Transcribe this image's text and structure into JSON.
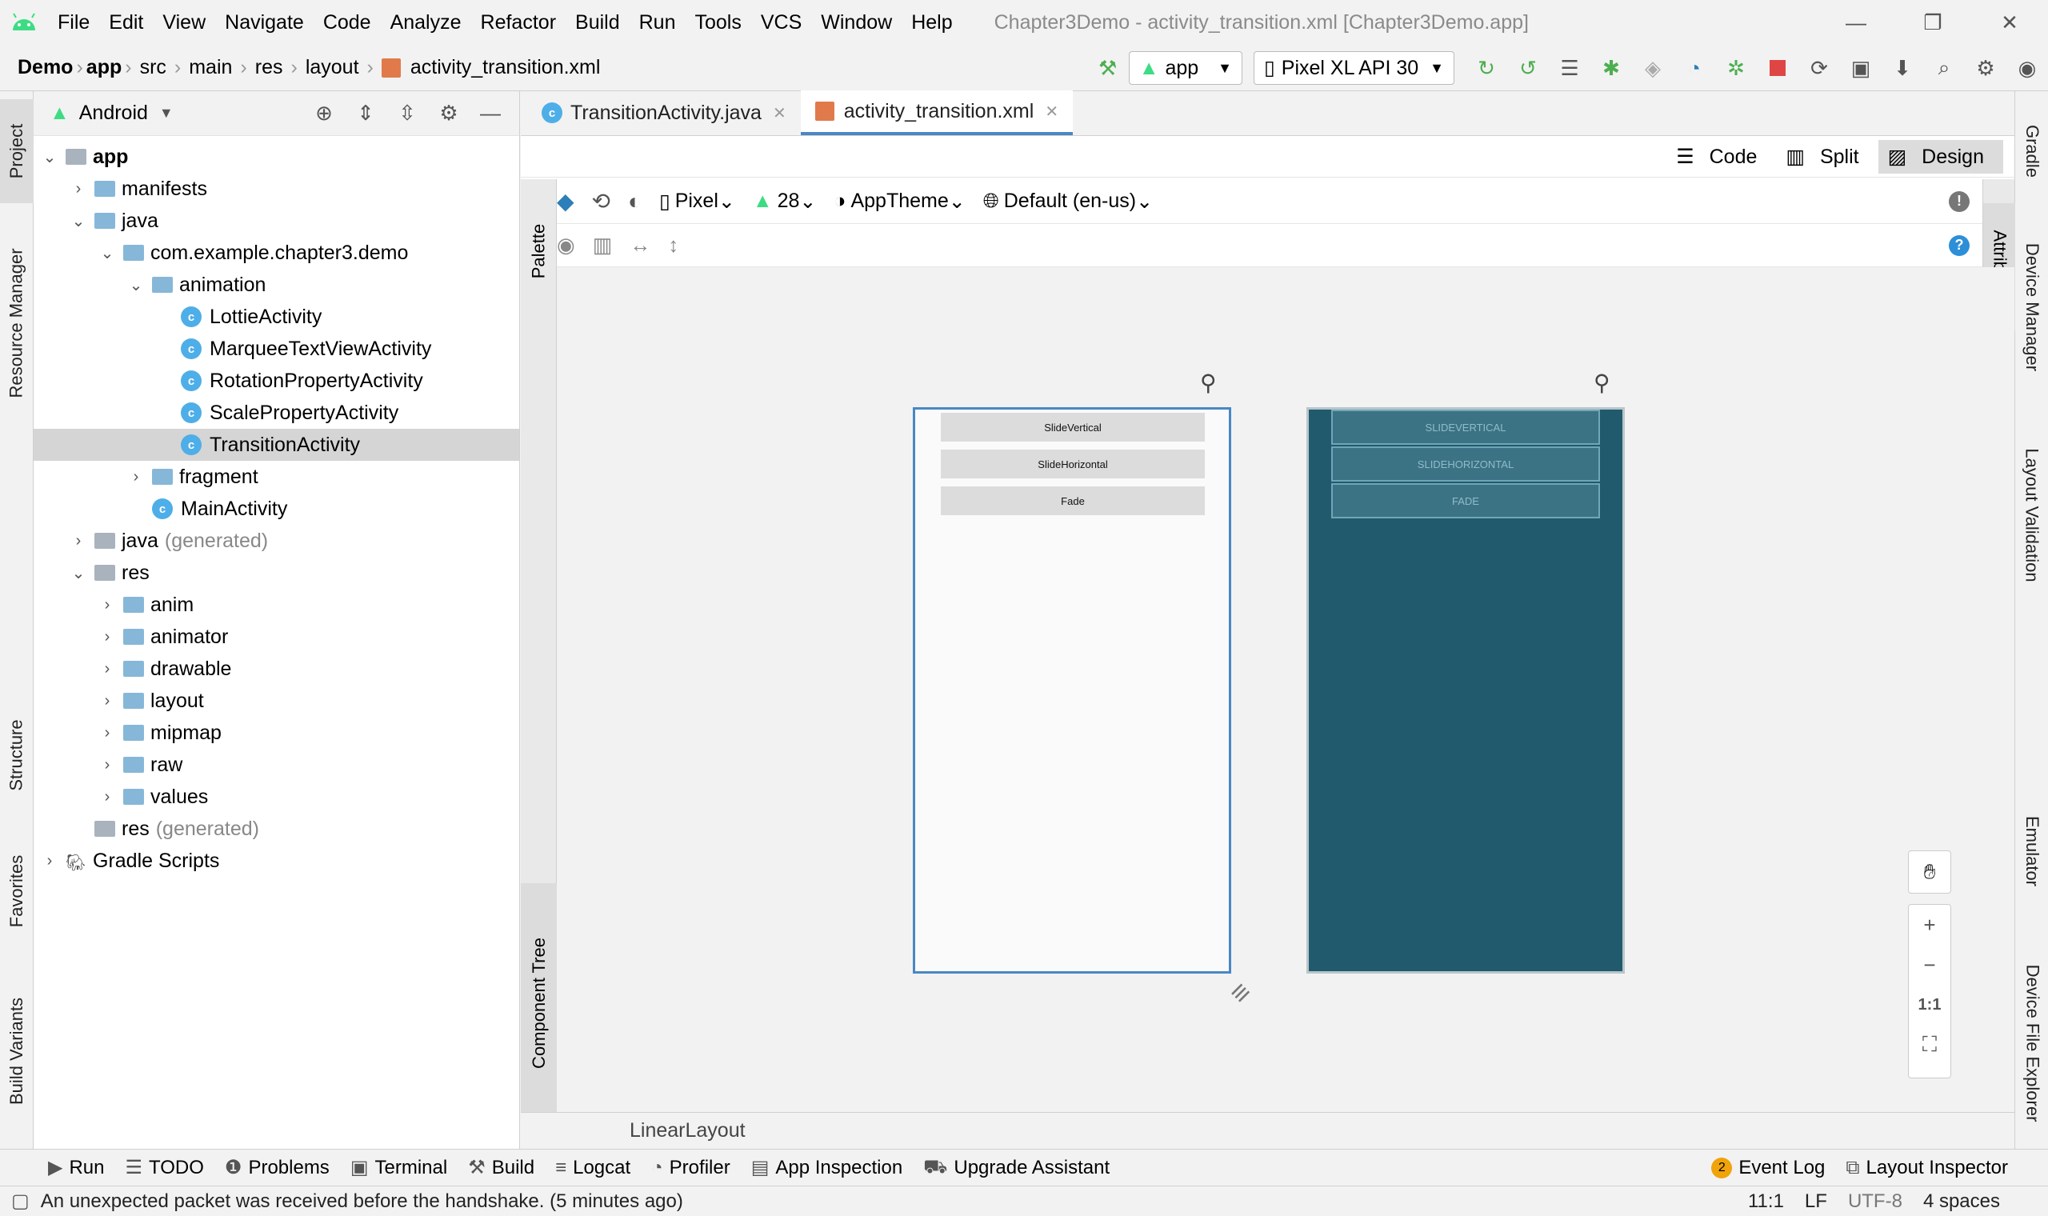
{
  "menubar": {
    "items": [
      "File",
      "Edit",
      "View",
      "Navigate",
      "Code",
      "Analyze",
      "Refactor",
      "Build",
      "Run",
      "Tools",
      "VCS",
      "Window",
      "Help"
    ],
    "title": "Chapter3Demo - activity_transition.xml [Chapter3Demo.app]"
  },
  "breadcrumb": [
    "Demo",
    "app",
    "src",
    "main",
    "res",
    "layout",
    "activity_transition.xml"
  ],
  "toolbar": {
    "run_config": "app",
    "device": "Pixel XL API 30"
  },
  "project": {
    "view_mode": "Android",
    "tree": [
      {
        "label": "app",
        "indent": 0,
        "arrow": "v",
        "type": "folder",
        "bold": true
      },
      {
        "label": "manifests",
        "indent": 1,
        "arrow": ">",
        "type": "folder"
      },
      {
        "label": "java",
        "indent": 1,
        "arrow": "v",
        "type": "folder"
      },
      {
        "label": "com.example.chapter3.demo",
        "indent": 2,
        "arrow": "v",
        "type": "folder"
      },
      {
        "label": "animation",
        "indent": 3,
        "arrow": "v",
        "type": "folder"
      },
      {
        "label": "LottieActivity",
        "indent": 4,
        "arrow": "",
        "type": "class"
      },
      {
        "label": "MarqueeTextViewActivity",
        "indent": 4,
        "arrow": "",
        "type": "class"
      },
      {
        "label": "RotationPropertyActivity",
        "indent": 4,
        "arrow": "",
        "type": "class"
      },
      {
        "label": "ScalePropertyActivity",
        "indent": 4,
        "arrow": "",
        "type": "class"
      },
      {
        "label": "TransitionActivity",
        "indent": 4,
        "arrow": "",
        "type": "class",
        "selected": true
      },
      {
        "label": "fragment",
        "indent": 3,
        "arrow": ">",
        "type": "folder"
      },
      {
        "label": "MainActivity",
        "indent": 3,
        "arrow": "",
        "type": "class"
      },
      {
        "label": "java",
        "suffix": "(generated)",
        "indent": 1,
        "arrow": ">",
        "type": "folder"
      },
      {
        "label": "res",
        "indent": 1,
        "arrow": "v",
        "type": "folder"
      },
      {
        "label": "anim",
        "indent": 2,
        "arrow": ">",
        "type": "folder"
      },
      {
        "label": "animator",
        "indent": 2,
        "arrow": ">",
        "type": "folder"
      },
      {
        "label": "drawable",
        "indent": 2,
        "arrow": ">",
        "type": "folder"
      },
      {
        "label": "layout",
        "indent": 2,
        "arrow": ">",
        "type": "folder"
      },
      {
        "label": "mipmap",
        "indent": 2,
        "arrow": ">",
        "type": "folder"
      },
      {
        "label": "raw",
        "indent": 2,
        "arrow": ">",
        "type": "folder"
      },
      {
        "label": "values",
        "indent": 2,
        "arrow": ">",
        "type": "folder"
      },
      {
        "label": "res",
        "suffix": "(generated)",
        "indent": 1,
        "arrow": "",
        "type": "folder"
      },
      {
        "label": "Gradle Scripts",
        "indent": 0,
        "arrow": ">",
        "type": "gradle"
      }
    ]
  },
  "left_tabs": [
    "Project",
    "Resource Manager",
    "Structure",
    "Favorites",
    "Build Variants"
  ],
  "right_tabs": [
    "Gradle",
    "Device Manager",
    "Layout Validation",
    "Emulator",
    "Device File Explorer"
  ],
  "editor": {
    "tabs": [
      {
        "label": "TransitionActivity.java",
        "active": false
      },
      {
        "label": "activity_transition.xml",
        "active": true
      }
    ],
    "view_modes": [
      "Code",
      "Split",
      "Design"
    ],
    "active_view": "Design",
    "design_toolbar": {
      "device": "Pixel",
      "api": "28",
      "theme": "AppTheme",
      "locale": "Default (en-us)"
    },
    "palette_label": "Palette",
    "component_tree_label": "Component Tree",
    "attributes_label": "Attributes",
    "bottom_label": "LinearLayout",
    "preview_buttons": [
      "SlideVertical",
      "SlideHorizontal",
      "Fade"
    ],
    "blueprint_buttons": [
      "SLIDEVERTICAL",
      "SLIDEHORIZONTAL",
      "FADE"
    ],
    "zoom": {
      "plus": "+",
      "minus": "−",
      "one": "1:1"
    }
  },
  "toolwindows": [
    "Run",
    "TODO",
    "Problems",
    "Terminal",
    "Build",
    "Logcat",
    "Profiler",
    "App Inspection",
    "Upgrade Assistant"
  ],
  "event_log": {
    "count": "2",
    "label": "Event Log"
  },
  "layout_inspector": "Layout Inspector",
  "status": {
    "message": "An unexpected packet was received before the handshake. (5 minutes ago)",
    "position": "11:1",
    "line_sep": "LF",
    "encoding": "UTF-8",
    "indent": "4 spaces"
  }
}
